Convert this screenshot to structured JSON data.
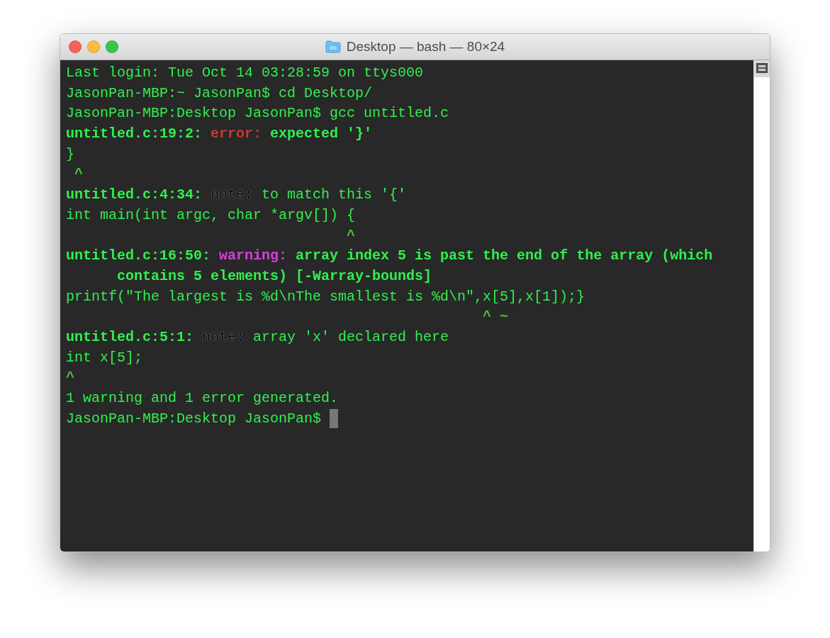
{
  "window": {
    "title": "Desktop — bash — 80×24"
  },
  "lines": [
    {
      "segments": [
        {
          "kind": "plain",
          "text": "Last login: Tue Oct 14 03:28:59 on ttys000"
        }
      ]
    },
    {
      "segments": [
        {
          "kind": "plain",
          "text": "JasonPan-MBP:~ JasonPan$ cd Desktop/"
        }
      ]
    },
    {
      "segments": [
        {
          "kind": "plain",
          "text": "JasonPan-MBP:Desktop JasonPan$ gcc untitled.c"
        }
      ]
    },
    {
      "segments": [
        {
          "kind": "bold",
          "text": "untitled.c:19:2: "
        },
        {
          "kind": "error",
          "text": "error:"
        },
        {
          "kind": "bold",
          "text": " expected '}'"
        }
      ]
    },
    {
      "segments": [
        {
          "kind": "plain",
          "text": "}"
        }
      ]
    },
    {
      "segments": [
        {
          "kind": "caret",
          "text": " ^"
        }
      ]
    },
    {
      "segments": [
        {
          "kind": "bold",
          "text": "untitled.c:4:34: "
        },
        {
          "kind": "note",
          "text": "note:"
        },
        {
          "kind": "plain",
          "text": " to match this '{'"
        }
      ]
    },
    {
      "segments": [
        {
          "kind": "plain",
          "text": "int main(int argc, char *argv"
        },
        {
          "kind": "box",
          "text": "[]"
        },
        {
          "kind": "plain",
          "text": ") {"
        }
      ]
    },
    {
      "segments": [
        {
          "kind": "caret",
          "text": "                                 ^"
        }
      ]
    },
    {
      "segments": [
        {
          "kind": "bold",
          "text": "untitled.c:16:50: "
        },
        {
          "kind": "warning",
          "text": "warning:"
        },
        {
          "kind": "bold",
          "text": " array index 5 is past the end of the array (which"
        }
      ]
    },
    {
      "segments": [
        {
          "kind": "bold",
          "text": "      contains 5 elements) [-Warray-bounds]"
        }
      ]
    },
    {
      "segments": [
        {
          "kind": "plain",
          "text": "printf(\"The largest is %d\\nThe smallest is %d\\n\",x[5],x[1]);}"
        }
      ]
    },
    {
      "segments": [
        {
          "kind": "caret",
          "text": "                                                 ^ ~"
        }
      ]
    },
    {
      "segments": [
        {
          "kind": "bold",
          "text": "untitled.c:5:1: "
        },
        {
          "kind": "note",
          "text": "note:"
        },
        {
          "kind": "plain",
          "text": " array 'x' declared here"
        }
      ]
    },
    {
      "segments": [
        {
          "kind": "plain",
          "text": "int x[5];"
        }
      ]
    },
    {
      "segments": [
        {
          "kind": "caret",
          "text": "^"
        }
      ]
    },
    {
      "segments": [
        {
          "kind": "plain",
          "text": "1 warning and 1 error generated."
        }
      ]
    },
    {
      "segments": [
        {
          "kind": "plain",
          "text": "JasonPan-MBP:Desktop JasonPan$ "
        }
      ],
      "cursor": true
    }
  ]
}
